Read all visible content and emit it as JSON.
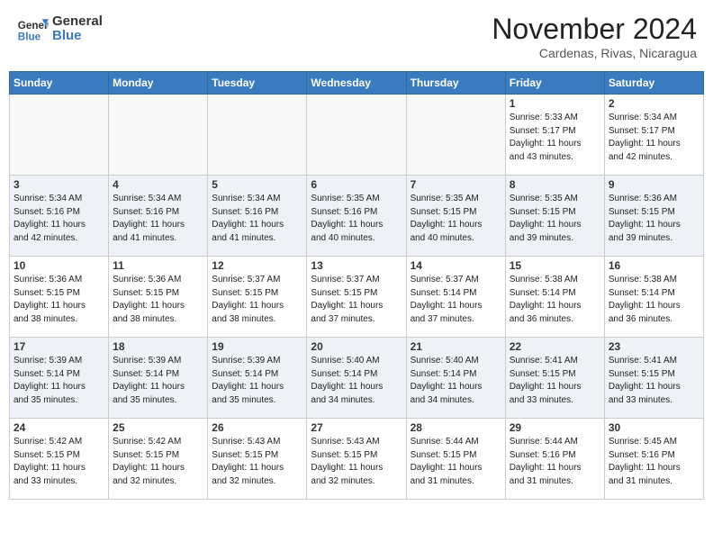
{
  "logo": {
    "line1": "General",
    "line2": "Blue"
  },
  "title": "November 2024",
  "location": "Cardenas, Rivas, Nicaragua",
  "days_header": [
    "Sunday",
    "Monday",
    "Tuesday",
    "Wednesday",
    "Thursday",
    "Friday",
    "Saturday"
  ],
  "weeks": [
    [
      {
        "num": "",
        "info": ""
      },
      {
        "num": "",
        "info": ""
      },
      {
        "num": "",
        "info": ""
      },
      {
        "num": "",
        "info": ""
      },
      {
        "num": "",
        "info": ""
      },
      {
        "num": "1",
        "info": "Sunrise: 5:33 AM\nSunset: 5:17 PM\nDaylight: 11 hours\nand 43 minutes."
      },
      {
        "num": "2",
        "info": "Sunrise: 5:34 AM\nSunset: 5:17 PM\nDaylight: 11 hours\nand 42 minutes."
      }
    ],
    [
      {
        "num": "3",
        "info": "Sunrise: 5:34 AM\nSunset: 5:16 PM\nDaylight: 11 hours\nand 42 minutes."
      },
      {
        "num": "4",
        "info": "Sunrise: 5:34 AM\nSunset: 5:16 PM\nDaylight: 11 hours\nand 41 minutes."
      },
      {
        "num": "5",
        "info": "Sunrise: 5:34 AM\nSunset: 5:16 PM\nDaylight: 11 hours\nand 41 minutes."
      },
      {
        "num": "6",
        "info": "Sunrise: 5:35 AM\nSunset: 5:16 PM\nDaylight: 11 hours\nand 40 minutes."
      },
      {
        "num": "7",
        "info": "Sunrise: 5:35 AM\nSunset: 5:15 PM\nDaylight: 11 hours\nand 40 minutes."
      },
      {
        "num": "8",
        "info": "Sunrise: 5:35 AM\nSunset: 5:15 PM\nDaylight: 11 hours\nand 39 minutes."
      },
      {
        "num": "9",
        "info": "Sunrise: 5:36 AM\nSunset: 5:15 PM\nDaylight: 11 hours\nand 39 minutes."
      }
    ],
    [
      {
        "num": "10",
        "info": "Sunrise: 5:36 AM\nSunset: 5:15 PM\nDaylight: 11 hours\nand 38 minutes."
      },
      {
        "num": "11",
        "info": "Sunrise: 5:36 AM\nSunset: 5:15 PM\nDaylight: 11 hours\nand 38 minutes."
      },
      {
        "num": "12",
        "info": "Sunrise: 5:37 AM\nSunset: 5:15 PM\nDaylight: 11 hours\nand 38 minutes."
      },
      {
        "num": "13",
        "info": "Sunrise: 5:37 AM\nSunset: 5:15 PM\nDaylight: 11 hours\nand 37 minutes."
      },
      {
        "num": "14",
        "info": "Sunrise: 5:37 AM\nSunset: 5:14 PM\nDaylight: 11 hours\nand 37 minutes."
      },
      {
        "num": "15",
        "info": "Sunrise: 5:38 AM\nSunset: 5:14 PM\nDaylight: 11 hours\nand 36 minutes."
      },
      {
        "num": "16",
        "info": "Sunrise: 5:38 AM\nSunset: 5:14 PM\nDaylight: 11 hours\nand 36 minutes."
      }
    ],
    [
      {
        "num": "17",
        "info": "Sunrise: 5:39 AM\nSunset: 5:14 PM\nDaylight: 11 hours\nand 35 minutes."
      },
      {
        "num": "18",
        "info": "Sunrise: 5:39 AM\nSunset: 5:14 PM\nDaylight: 11 hours\nand 35 minutes."
      },
      {
        "num": "19",
        "info": "Sunrise: 5:39 AM\nSunset: 5:14 PM\nDaylight: 11 hours\nand 35 minutes."
      },
      {
        "num": "20",
        "info": "Sunrise: 5:40 AM\nSunset: 5:14 PM\nDaylight: 11 hours\nand 34 minutes."
      },
      {
        "num": "21",
        "info": "Sunrise: 5:40 AM\nSunset: 5:14 PM\nDaylight: 11 hours\nand 34 minutes."
      },
      {
        "num": "22",
        "info": "Sunrise: 5:41 AM\nSunset: 5:15 PM\nDaylight: 11 hours\nand 33 minutes."
      },
      {
        "num": "23",
        "info": "Sunrise: 5:41 AM\nSunset: 5:15 PM\nDaylight: 11 hours\nand 33 minutes."
      }
    ],
    [
      {
        "num": "24",
        "info": "Sunrise: 5:42 AM\nSunset: 5:15 PM\nDaylight: 11 hours\nand 33 minutes."
      },
      {
        "num": "25",
        "info": "Sunrise: 5:42 AM\nSunset: 5:15 PM\nDaylight: 11 hours\nand 32 minutes."
      },
      {
        "num": "26",
        "info": "Sunrise: 5:43 AM\nSunset: 5:15 PM\nDaylight: 11 hours\nand 32 minutes."
      },
      {
        "num": "27",
        "info": "Sunrise: 5:43 AM\nSunset: 5:15 PM\nDaylight: 11 hours\nand 32 minutes."
      },
      {
        "num": "28",
        "info": "Sunrise: 5:44 AM\nSunset: 5:15 PM\nDaylight: 11 hours\nand 31 minutes."
      },
      {
        "num": "29",
        "info": "Sunrise: 5:44 AM\nSunset: 5:16 PM\nDaylight: 11 hours\nand 31 minutes."
      },
      {
        "num": "30",
        "info": "Sunrise: 5:45 AM\nSunset: 5:16 PM\nDaylight: 11 hours\nand 31 minutes."
      }
    ]
  ]
}
